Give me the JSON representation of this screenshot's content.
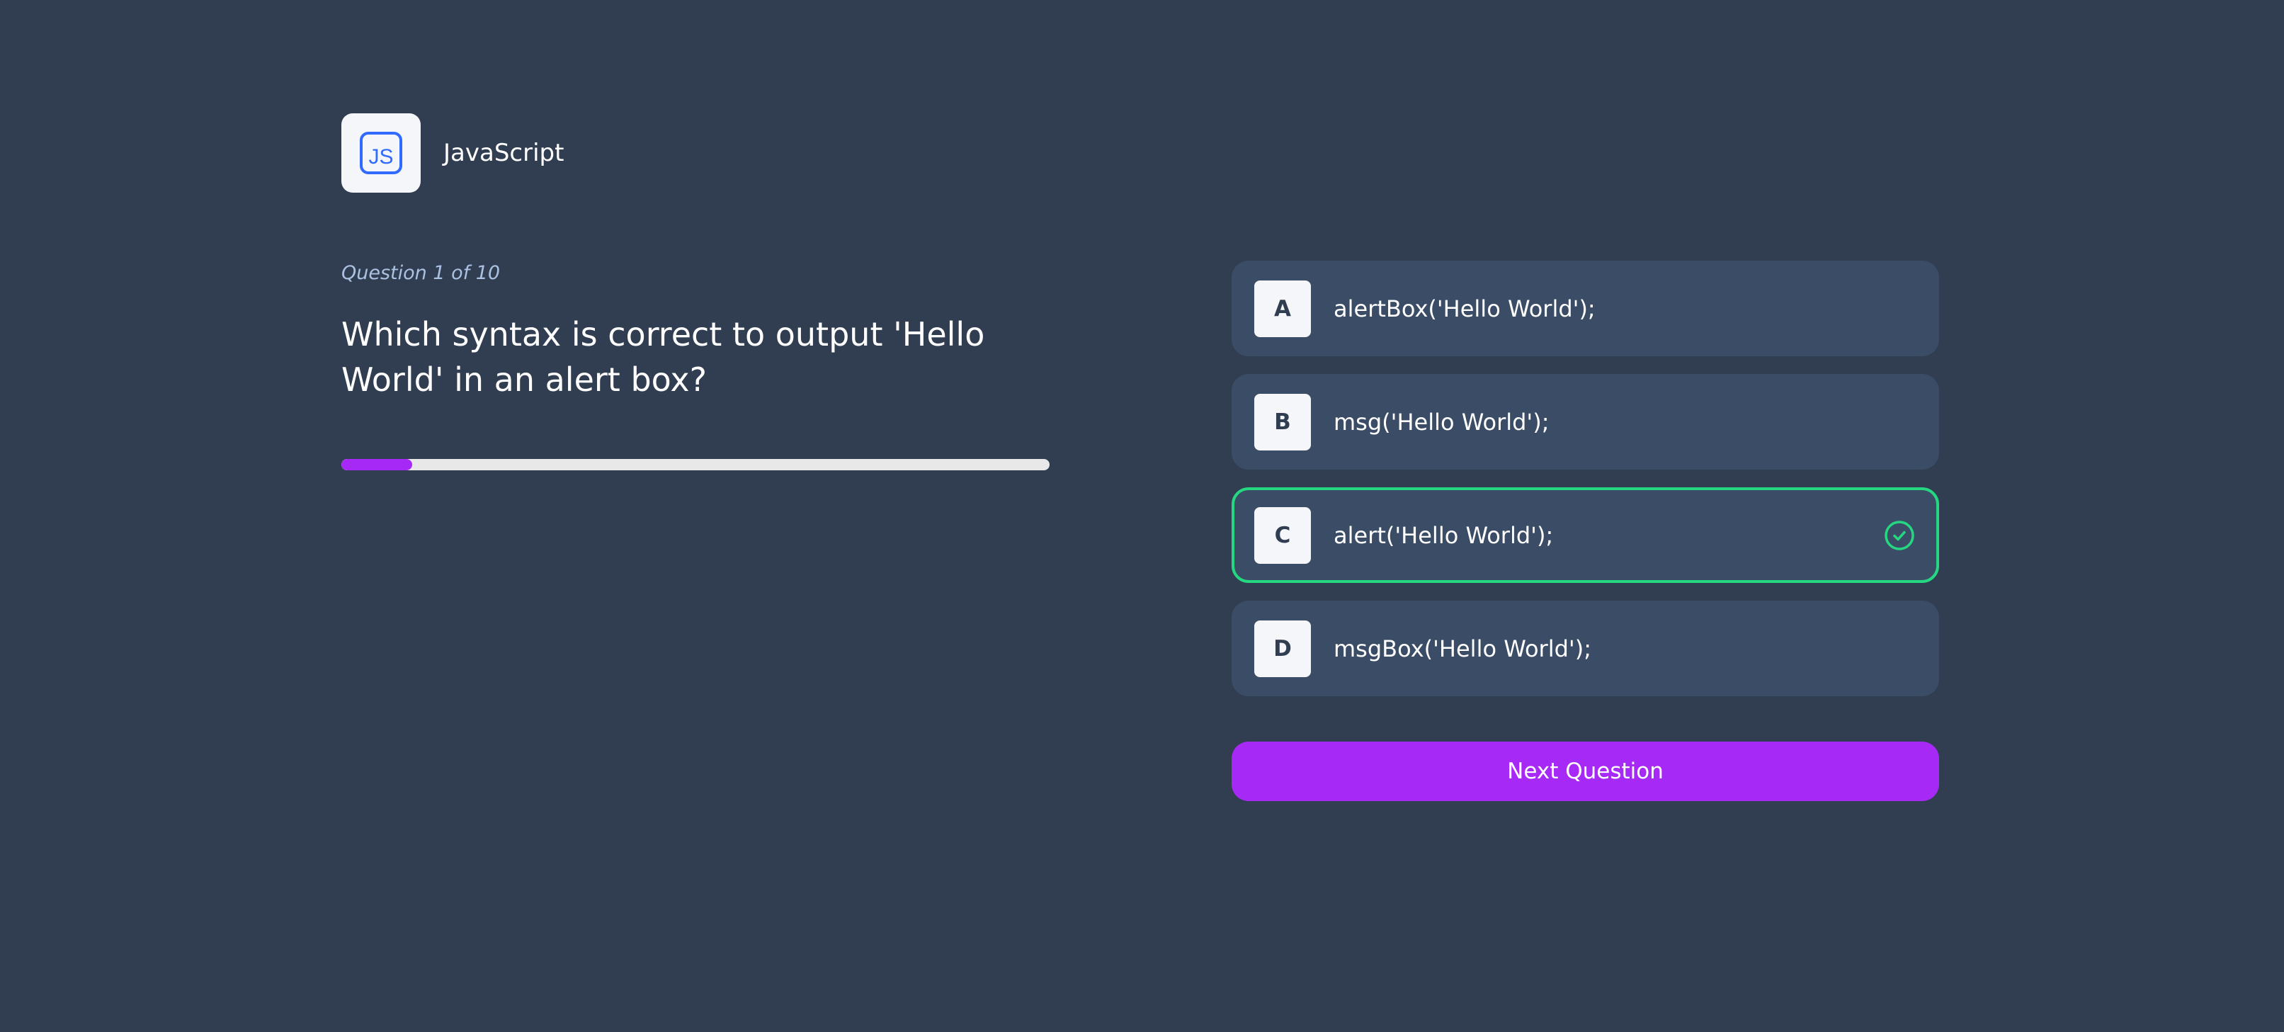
{
  "header": {
    "subject_title": "JavaScript",
    "subject_icon": "js-icon",
    "icon_color": "#306AFF"
  },
  "question": {
    "counter": "Question 1 of 10",
    "text": "Which syntax is correct to output 'Hello World' in an alert box?",
    "progress_fraction": 0.1
  },
  "options": [
    {
      "letter": "A",
      "text": "alertBox('Hello World');",
      "state": "default"
    },
    {
      "letter": "B",
      "text": "msg('Hello World');",
      "state": "default"
    },
    {
      "letter": "C",
      "text": "alert('Hello World');",
      "state": "correct"
    },
    {
      "letter": "D",
      "text": "msgBox('Hello World');",
      "state": "default"
    }
  ],
  "actions": {
    "next_label": "Next Question"
  },
  "colors": {
    "background": "#313E51",
    "card": "#3B4D66",
    "accent": "#A729F5",
    "correct": "#26D782",
    "muted_text": "#ABC1E1"
  }
}
